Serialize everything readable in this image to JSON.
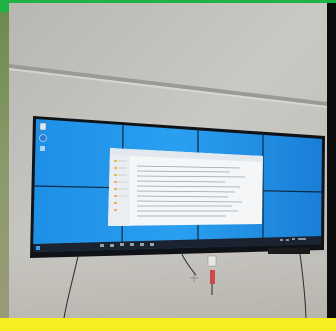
{
  "scene": {
    "subject": "video-wall",
    "wall_grid": {
      "rows": 2,
      "cols": 4
    },
    "desktop_icons": [
      "recycle-bin-icon",
      "browser-icon"
    ],
    "colors": {
      "frame_green": "#1db445",
      "frame_yellow": "#f6ee1e",
      "wall": "#c8c6c0",
      "desktop_blue": "#1a8fe0",
      "taskbar": "#1b2230"
    }
  }
}
